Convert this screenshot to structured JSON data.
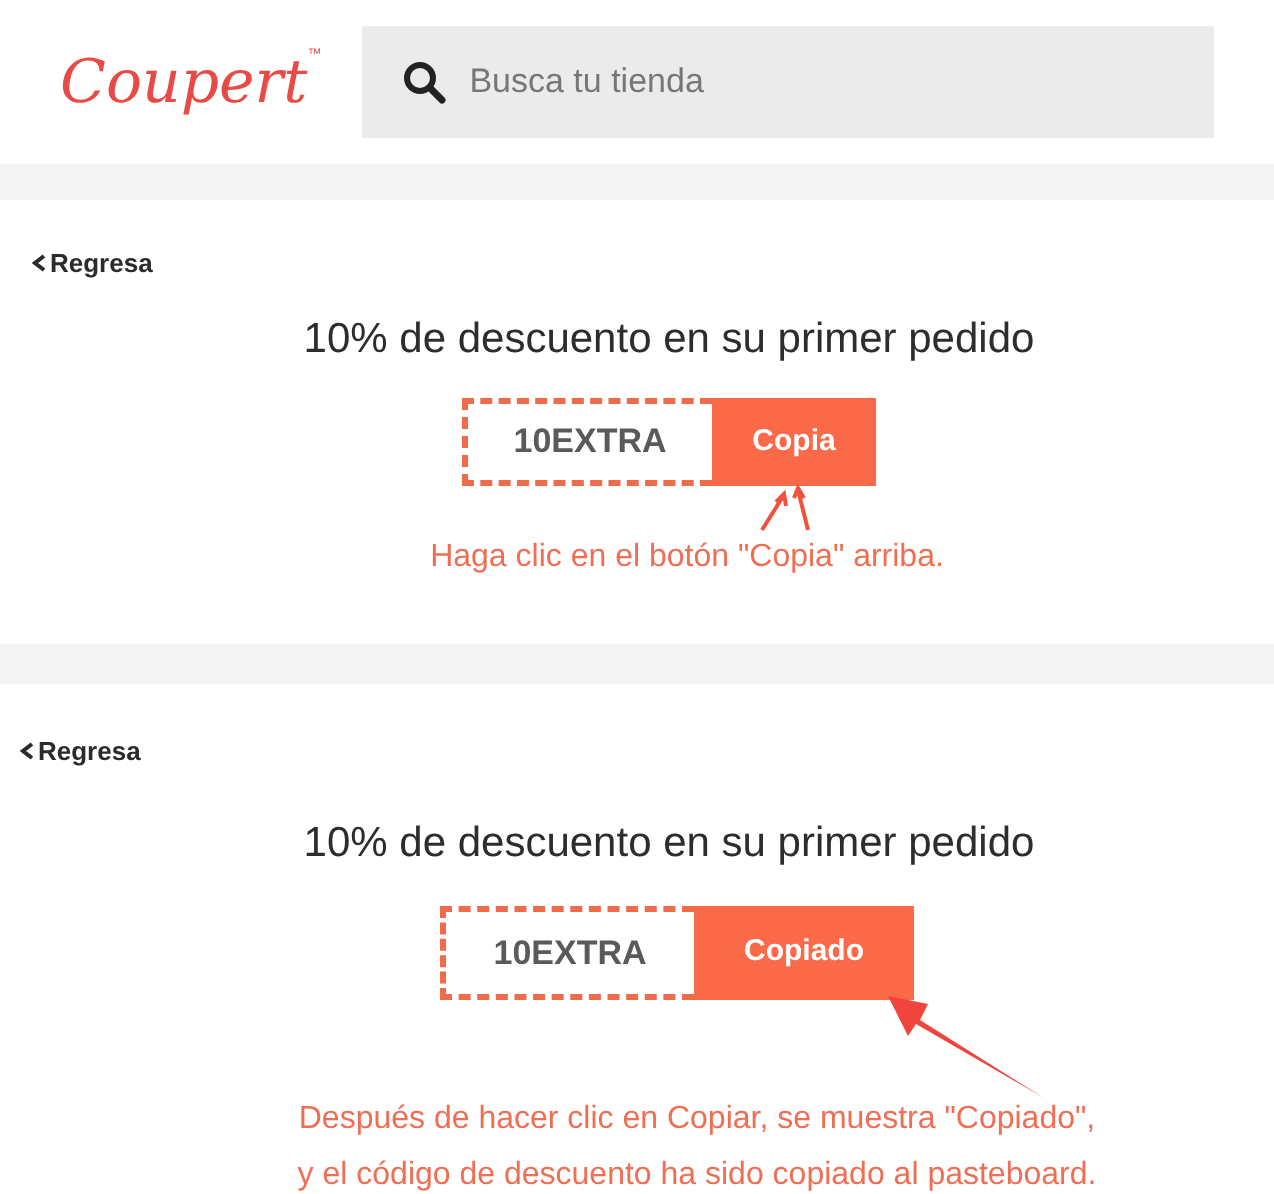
{
  "header": {
    "logo": "Coupert",
    "trademark": "™",
    "search": {
      "placeholder": "Busca tu tienda"
    }
  },
  "panels": [
    {
      "back_label": "Regresa",
      "title": "10% de descuento en su primer pedido",
      "code": "10EXTRA",
      "button_label": "Copia",
      "annotation": {
        "kind": "pointers",
        "lines": [
          "Haga clic en el botón \"Copia\" arriba."
        ]
      }
    },
    {
      "back_label": "Regresa",
      "title": "10% de descuento en su primer pedido",
      "code": "10EXTRA",
      "button_label": "Copiado",
      "annotation": {
        "kind": "arrow",
        "lines": [
          "Después de hacer clic en Copiar, se muestra \"Copiado\",",
          "y el código de descuento ha sido copiado al pasteboard."
        ]
      }
    }
  ]
}
